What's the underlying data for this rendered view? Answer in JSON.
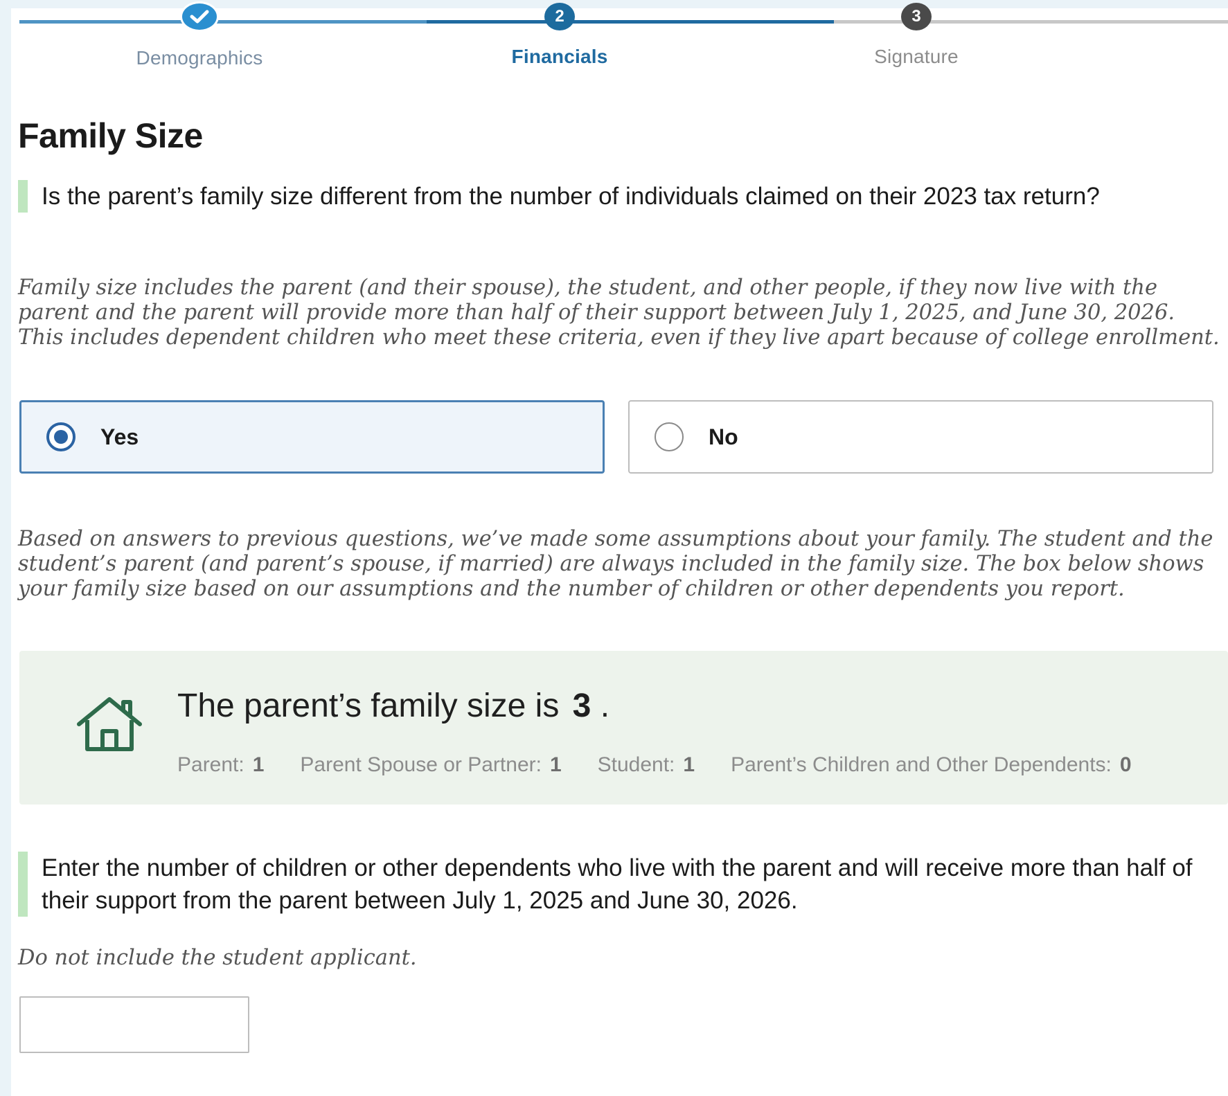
{
  "stepper": {
    "steps": [
      {
        "number": "1",
        "label": "Demographics",
        "state": "complete"
      },
      {
        "number": "2",
        "label": "Financials",
        "state": "current"
      },
      {
        "number": "3",
        "label": "Signature",
        "state": "upcoming"
      }
    ]
  },
  "page_title": "Family Size",
  "question1": {
    "text": "Is the parent’s family size different from the number of individuals claimed on their 2023 tax return?",
    "help": "Family size includes the parent (and their spouse), the student, and other people, if they now live with the parent and the parent will provide more than half of their support between July 1, 2025, and June 30, 2026. This includes dependent children who meet these criteria, even if they live apart because of college enrollment.",
    "options": [
      {
        "label": "Yes",
        "selected": true
      },
      {
        "label": "No",
        "selected": false
      }
    ]
  },
  "assumptions_text": "Based on answers to previous questions, we’ve made some assumptions about your family. The student and the student’s parent (and parent’s spouse, if married) are always included in the family size. The box below shows your family size based on our assumptions and the number of children or other dependents you report.",
  "family_box": {
    "icon": "house-icon",
    "lead": "The parent’s family size is",
    "size": "3",
    "trail": ".",
    "breakdown": [
      {
        "label": "Parent:",
        "value": "1"
      },
      {
        "label": "Parent Spouse or Partner:",
        "value": "1"
      },
      {
        "label": "Student:",
        "value": "1"
      },
      {
        "label": "Parent’s Children and Other Dependents:",
        "value": "0"
      }
    ]
  },
  "question2": {
    "text": "Enter the number of children or other dependents who live with the parent and will receive more than half of their support from the parent between July 1, 2025 and June 30, 2026.",
    "help": "Do not include the student applicant.",
    "input_value": "",
    "input_placeholder": ""
  },
  "colors": {
    "accent": "#1f6aa0",
    "selected_border": "#4a80b3",
    "question_bar": "#bfe6bf",
    "family_box_bg": "#edf3ec",
    "house_icon": "#2e6b4b"
  }
}
